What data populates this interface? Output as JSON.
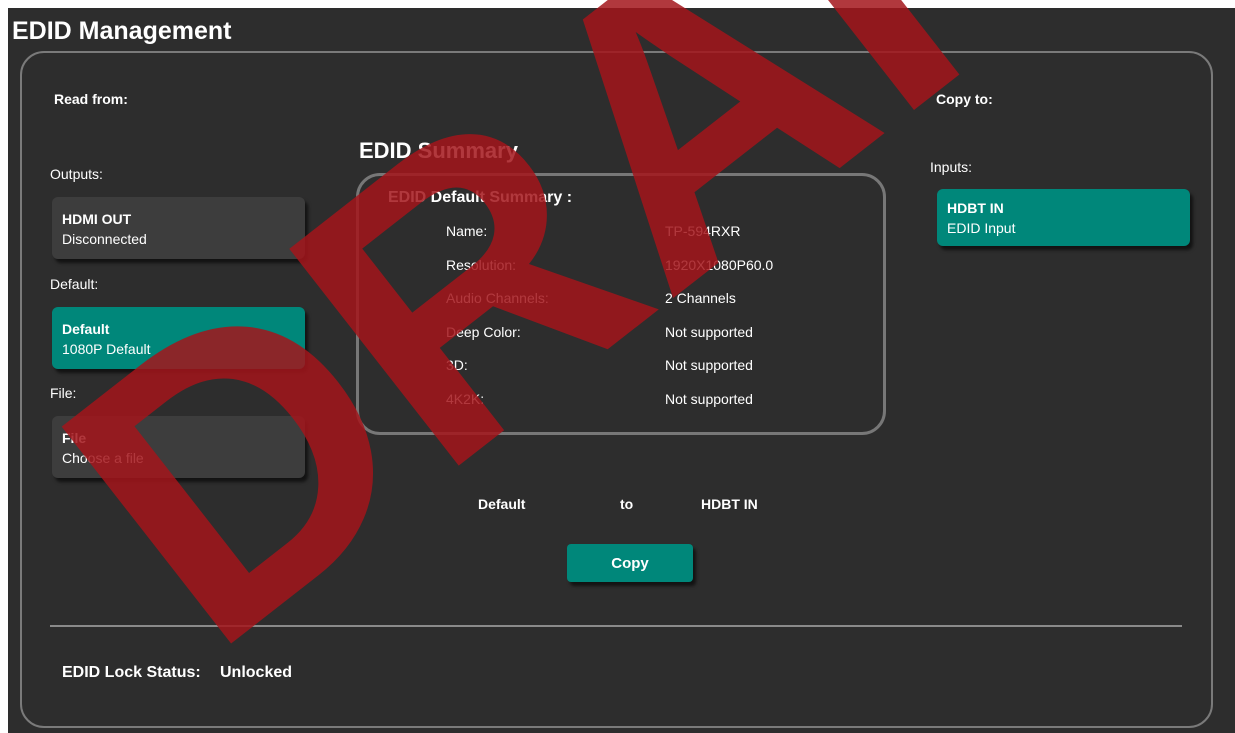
{
  "title": "EDID Management",
  "read_from": {
    "label": "Read from:",
    "outputs_label": "Outputs:",
    "outputs": [
      {
        "title": "HDMI OUT",
        "subtitle": "Disconnected"
      }
    ],
    "default_label": "Default:",
    "default_card": {
      "title": "Default",
      "subtitle": "1080P Default"
    },
    "file_label": "File:",
    "file_card": {
      "title": "File",
      "subtitle": "Choose a file"
    }
  },
  "summary": {
    "title": "EDID Summary",
    "heading": "EDID Default Summary :",
    "rows": [
      {
        "key": "Name:",
        "value": "TP-594RXR"
      },
      {
        "key": "Resolution:",
        "value": "1920X1080P60.0"
      },
      {
        "key": "Audio Channels:",
        "value": "2 Channels"
      },
      {
        "key": "Deep Color:",
        "value": "Not supported"
      },
      {
        "key": "3D:",
        "value": "Not supported"
      },
      {
        "key": "4K2K:",
        "value": "Not supported"
      }
    ]
  },
  "copy_to": {
    "label": "Copy to:",
    "inputs_label": "Inputs:",
    "inputs": [
      {
        "title": "HDBT IN",
        "subtitle": "EDID Input"
      }
    ]
  },
  "transfer": {
    "source": "Default",
    "to": "to",
    "target": "HDBT IN",
    "copy_label": "Copy"
  },
  "lock_status": {
    "label": "EDID Lock Status:",
    "value": "Unlocked"
  },
  "watermark": "DRAFT",
  "colors": {
    "accent": "#00877a",
    "background": "#2d2d2d",
    "card": "#3d3d3d",
    "watermark": "#a3151b"
  }
}
